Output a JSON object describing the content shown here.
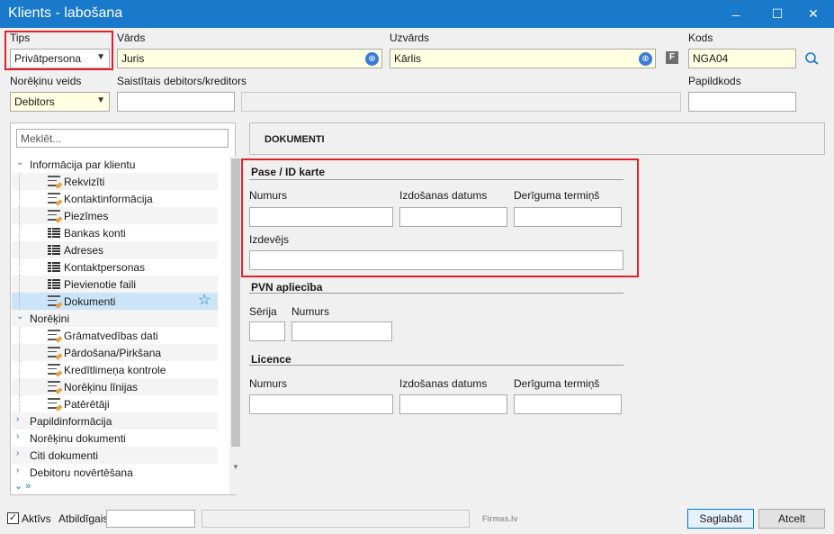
{
  "window": {
    "title": "Klients - labošana",
    "minimize": "–",
    "maximize": "☐",
    "close": "✕"
  },
  "header": {
    "tips_label": "Tips",
    "tips_value": "Privātpersona",
    "vards_label": "Vārds",
    "vards_value": "Juris",
    "uzvards_label": "Uzvārds",
    "uzvards_value": "Kārlis",
    "f_badge": "F",
    "kods_label": "Kods",
    "kods_value": "NGA04",
    "noreķinu_label": "Norēķinu veids",
    "noreķinu_value": "Debitors",
    "saistitais_label": "Saistītais debitors/kreditors",
    "saistitais_value": "",
    "saistitais_name": "",
    "papildkods_label": "Papildkods",
    "papildkods_value": ""
  },
  "tree": {
    "search_placeholder": "Meklēt...",
    "items": [
      {
        "label": "Informācija par klientu",
        "kind": "group",
        "open": true
      },
      {
        "label": "Rekvizīti",
        "kind": "doc"
      },
      {
        "label": "Kontaktinformācija",
        "kind": "doc"
      },
      {
        "label": "Piezīmes",
        "kind": "doc"
      },
      {
        "label": "Bankas konti",
        "kind": "grid"
      },
      {
        "label": "Adreses",
        "kind": "grid"
      },
      {
        "label": "Kontaktpersonas",
        "kind": "grid"
      },
      {
        "label": "Pievienotie faili",
        "kind": "grid"
      },
      {
        "label": "Dokumenti",
        "kind": "doc",
        "selected": true
      },
      {
        "label": "Norēķini",
        "kind": "group",
        "open": true
      },
      {
        "label": "Grāmatvedības dati",
        "kind": "doc"
      },
      {
        "label": "Pārdošana/Pirkšana",
        "kind": "doc"
      },
      {
        "label": "Kredītlimeņa kontrole",
        "kind": "doc"
      },
      {
        "label": "Norēķinu līnijas",
        "kind": "doc"
      },
      {
        "label": "Patērētāji",
        "kind": "doc"
      },
      {
        "label": "Papildinformācija",
        "kind": "group",
        "open": false
      },
      {
        "label": "Norēķinu dokumenti",
        "kind": "group",
        "open": false
      },
      {
        "label": "Citi dokumenti",
        "kind": "group",
        "open": false
      },
      {
        "label": "Debitoru novērtēšana",
        "kind": "group",
        "open": false
      }
    ]
  },
  "main": {
    "panel_title": "DOKUMENTI",
    "pase": {
      "title": "Pase / ID karte",
      "numurs_label": "Numurs",
      "numurs_value": "",
      "izdosanas_label": "Izdošanas datums",
      "izdosanas_value": "",
      "deriguma_label": "Derīguma termiņš",
      "deriguma_value": "",
      "izdevejs_label": "Izdevējs",
      "izdevejs_value": ""
    },
    "pvn": {
      "title": "PVN apliecība",
      "serija_label": "Sērija",
      "serija_value": "",
      "numurs_label": "Numurs",
      "numurs_value": ""
    },
    "licence": {
      "title": "Licence",
      "numurs_label": "Numurs",
      "numurs_value": "",
      "izdosanas_label": "Izdošanas datums",
      "izdosanas_value": "",
      "deriguma_label": "Derīguma termiņš",
      "deriguma_value": ""
    }
  },
  "footer": {
    "aktivs_label": "Aktīvs",
    "atbildigais_label": "Atbildīgais",
    "atbildigais_value": "",
    "atbildigais_name": "",
    "brand": "Firmas.lv",
    "save_label": "Saglabāt",
    "cancel_label": "Atcelt"
  },
  "colors": {
    "accent": "#1979ca",
    "highlight": "#e0212b",
    "selected_row": "#cce4f7",
    "required_field": "#ffffe1"
  },
  "icons": {
    "globe": "globe-icon",
    "search_contact": "search-contact-icon",
    "star": "star-icon"
  }
}
